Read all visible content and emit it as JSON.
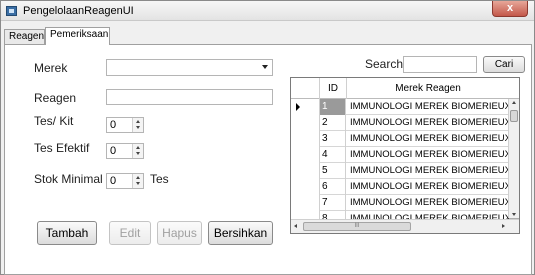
{
  "window": {
    "title": "PengelolaanReagenUI",
    "close_label": "x"
  },
  "tabs": [
    {
      "label": "Reagen",
      "active": false
    },
    {
      "label": "Pemeriksaan",
      "active": true
    }
  ],
  "form": {
    "merek_label": "Merek",
    "merek_value": "",
    "reagen_label": "Reagen",
    "reagen_value": "",
    "tes_kit_label": "Tes/ Kit",
    "tes_kit_value": "0",
    "tes_efektif_label": "Tes Efektif",
    "tes_efektif_value": "0",
    "stok_minimal_label": "Stok Minimal",
    "stok_minimal_value": "0",
    "stok_unit": "Tes"
  },
  "buttons": {
    "tambah": "Tambah",
    "edit": "Edit",
    "hapus": "Hapus",
    "bersihkan": "Bersihkan"
  },
  "search": {
    "label": "Search",
    "value": "",
    "button": "Cari"
  },
  "grid": {
    "columns": [
      "ID",
      "Merek Reagen"
    ],
    "selected_row": 0,
    "rows": [
      {
        "id": "1",
        "merek": "IMMUNOLOGI MEREK BIOMERIEUX"
      },
      {
        "id": "2",
        "merek": "IMMUNOLOGI MEREK BIOMERIEUX"
      },
      {
        "id": "3",
        "merek": "IMMUNOLOGI MEREK BIOMERIEUX"
      },
      {
        "id": "4",
        "merek": "IMMUNOLOGI MEREK BIOMERIEUX"
      },
      {
        "id": "5",
        "merek": "IMMUNOLOGI MEREK BIOMERIEUX"
      },
      {
        "id": "6",
        "merek": "IMMUNOLOGI MEREK BIOMERIEUX"
      },
      {
        "id": "7",
        "merek": "IMMUNOLOGI MEREK BIOMERIEUX"
      },
      {
        "id": "8",
        "merek": "IMMUNOLOGI MEREK BIOMERIEUX"
      }
    ],
    "hscroll_thumb": "III"
  }
}
